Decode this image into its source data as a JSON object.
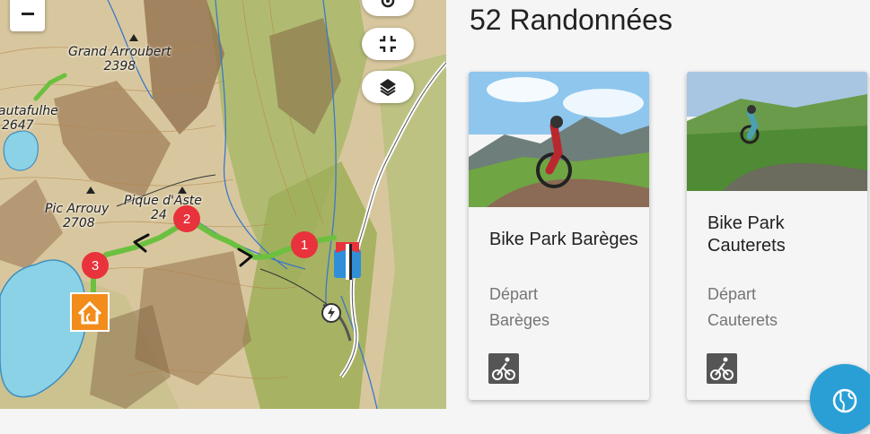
{
  "map": {
    "labels": [
      {
        "name": "Grand Arroubert",
        "elevation": "2398"
      },
      {
        "name": "autafulhe",
        "elevation": "2647"
      },
      {
        "name": "Pic Arrouy",
        "elevation": "2708"
      },
      {
        "name": "Pique d'Aste",
        "elevation": "24"
      }
    ],
    "markers": [
      "1",
      "2",
      "3"
    ],
    "controls": {
      "zoom_out": "zoom-out",
      "locate_icon": "location-pin-icon",
      "fullscreen_icon": "fullscreen-exit-icon",
      "layers_icon": "layers-icon"
    },
    "colors": {
      "route": "#6cc040",
      "marker": "#e8323c",
      "refuge": "#f28c1a",
      "parking": "#2f8fd8"
    }
  },
  "listing": {
    "title": "52 Randonnées",
    "cards": [
      {
        "name": "Bike Park Barèges",
        "start_label": "Départ",
        "start_city": "Barèges",
        "activity_icon": "mountain-bike-icon"
      },
      {
        "name": "Bike Park Cauterets",
        "start_label": "Départ",
        "start_city": "Cauterets",
        "activity_icon": "mountain-bike-icon"
      }
    ]
  },
  "fab": {
    "icon": "globe-icon",
    "color": "#2a9fd6"
  }
}
